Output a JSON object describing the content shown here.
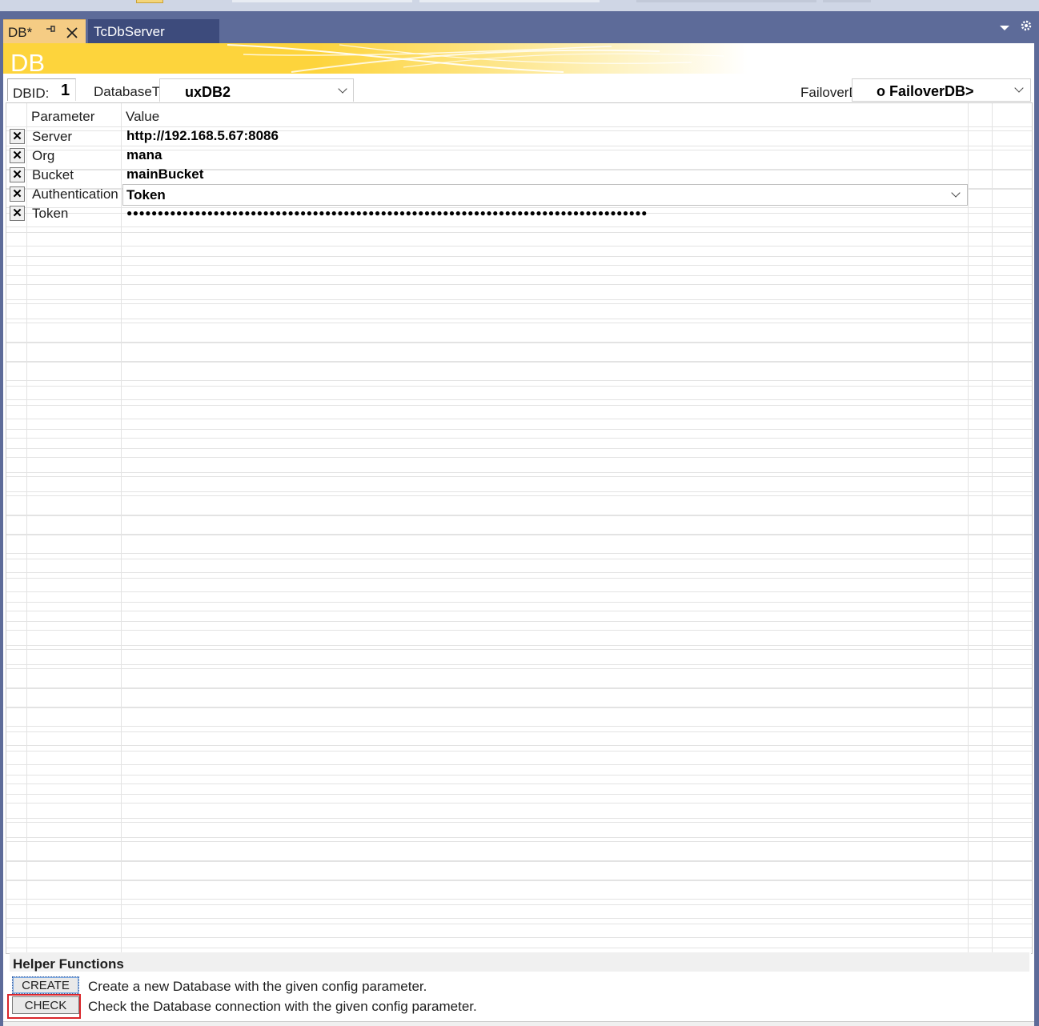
{
  "tabs": {
    "active": {
      "label": "DB*"
    },
    "inactive": {
      "label": "TcDbServer"
    }
  },
  "icons": {
    "pin": "pin-icon",
    "close": "close-icon",
    "dropdown": "chevron-down-icon",
    "settings": "gear-icon"
  },
  "banner": {
    "title": "DB"
  },
  "controls": {
    "dbid_label": "DBID:",
    "dbid_value": "1",
    "dbtype_label": "DatabaseType",
    "dbtype_value": "uxDB2",
    "failover_label": "FailoverDB:",
    "failover_value": "o FailoverDB>"
  },
  "grid": {
    "headers": {
      "parameter": "Parameter",
      "value": "Value"
    },
    "rows": [
      {
        "name": "Server",
        "value": "http://192.168.5.67:8086"
      },
      {
        "name": "Org",
        "value": "mana"
      },
      {
        "name": "Bucket",
        "value": "mainBucket"
      },
      {
        "name": "Authentication",
        "value": "Token"
      },
      {
        "name": "Token",
        "value": "●●●●●●●●●●●●●●●●●●●●●●●●●●●●●●●●●●●●●●●●●●●●●●●●●●●●●●●●●●●●●●●●●●●●●●●●●●●●●●●●●●●●"
      }
    ],
    "remove_glyph": "✕"
  },
  "helper": {
    "title": "Helper Functions",
    "create_label": "CREATE",
    "create_desc": "Create a new Database with the given config parameter.",
    "check_label": "CHECK",
    "check_desc": "Check the Database connection with the given config parameter."
  },
  "colors": {
    "tabbar": "#5d6b99",
    "active_tab": "#f5cc84",
    "banner_yellow": "#fdd43c",
    "highlight_box": "#d9262b"
  }
}
